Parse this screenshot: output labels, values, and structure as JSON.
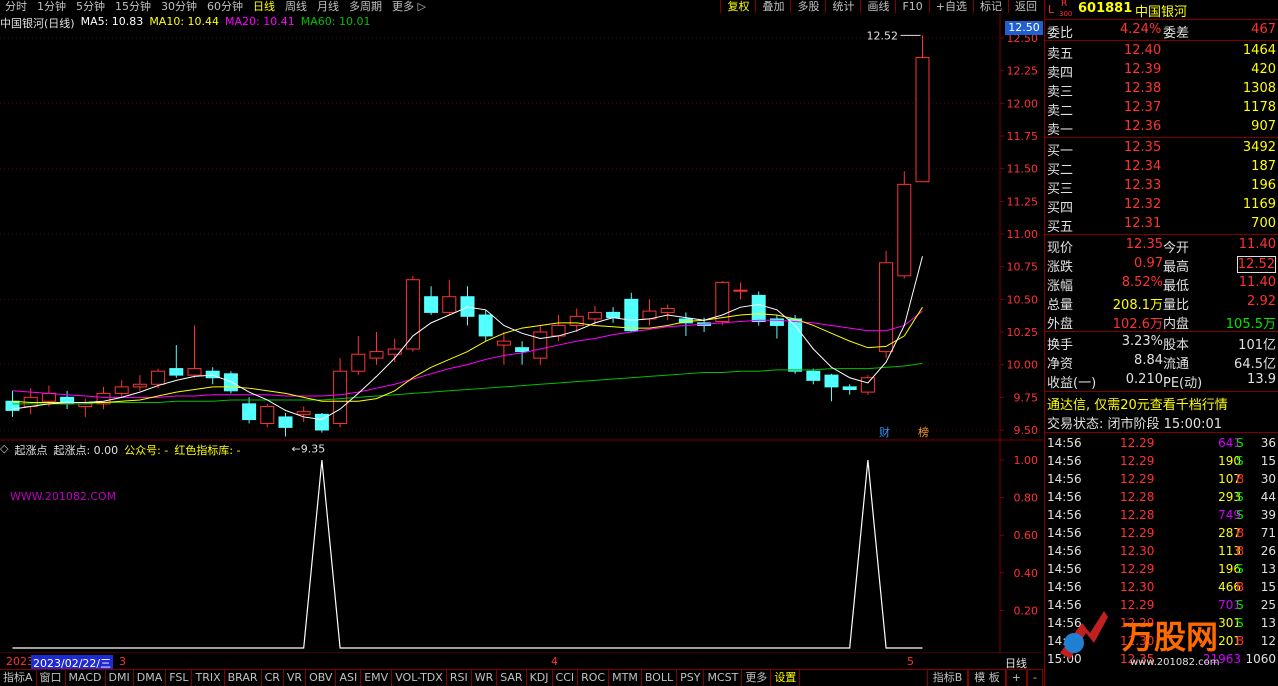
{
  "topbar": {
    "items": [
      {
        "label": "分时",
        "active": false
      },
      {
        "label": "1分钟",
        "active": false
      },
      {
        "label": "5分钟",
        "active": false
      },
      {
        "label": "15分钟",
        "active": false
      },
      {
        "label": "30分钟",
        "active": false
      },
      {
        "label": "60分钟",
        "active": false
      },
      {
        "label": "日线",
        "active": true
      },
      {
        "label": "周线",
        "active": false
      },
      {
        "label": "月线",
        "active": false
      },
      {
        "label": "多周期",
        "active": false
      },
      {
        "label": "更多 ▷",
        "active": false
      }
    ],
    "right_items": [
      {
        "label": "复权",
        "active": true
      },
      {
        "label": "叠加",
        "active": false
      },
      {
        "label": "多股",
        "active": false
      },
      {
        "label": "统计",
        "active": false
      },
      {
        "label": "画线",
        "active": false
      },
      {
        "label": "F10",
        "active": false
      },
      {
        "label": "+自选",
        "active": false
      },
      {
        "label": "标记",
        "active": false
      },
      {
        "label": "返回",
        "active": false
      }
    ]
  },
  "chart_info": {
    "stock_title": "中国银河(日线)",
    "ma5": "MA5: 10.83",
    "ma10": "MA10: 10.44",
    "ma20": "MA20: 10.41",
    "ma60": "MA60: 10.01",
    "current_price_tag": "12.50",
    "high_label": "12.52",
    "low_label": "9.35",
    "cai_badge": "财",
    "bang_badge": "榜"
  },
  "chart_data": [
    {
      "type": "candlestick",
      "title": "中国银河(日线)",
      "y_ticks": [
        "12.50",
        "12.25",
        "12.00",
        "11.75",
        "11.50",
        "11.25",
        "11.00",
        "10.75",
        "10.50",
        "10.25",
        "10.00",
        "9.75",
        "9.50"
      ],
      "ylim": [
        9.35,
        12.55
      ],
      "candles": [
        {
          "o": 9.72,
          "c": 9.65,
          "h": 9.8,
          "l": 9.6
        },
        {
          "o": 9.68,
          "c": 9.75,
          "h": 9.82,
          "l": 9.62
        },
        {
          "o": 9.72,
          "c": 9.78,
          "h": 9.84,
          "l": 9.68
        },
        {
          "o": 9.75,
          "c": 9.7,
          "h": 9.8,
          "l": 9.66
        },
        {
          "o": 9.68,
          "c": 9.7,
          "h": 9.74,
          "l": 9.6
        },
        {
          "o": 9.7,
          "c": 9.78,
          "h": 9.83,
          "l": 9.66
        },
        {
          "o": 9.78,
          "c": 9.83,
          "h": 9.88,
          "l": 9.75
        },
        {
          "o": 9.83,
          "c": 9.85,
          "h": 9.92,
          "l": 9.8
        },
        {
          "o": 9.85,
          "c": 9.95,
          "h": 9.97,
          "l": 9.82
        },
        {
          "o": 9.97,
          "c": 9.92,
          "h": 10.15,
          "l": 9.9
        },
        {
          "o": 9.92,
          "c": 9.97,
          "h": 10.3,
          "l": 9.9
        },
        {
          "o": 9.95,
          "c": 9.9,
          "h": 9.98,
          "l": 9.85
        },
        {
          "o": 9.93,
          "c": 9.8,
          "h": 9.95,
          "l": 9.78
        },
        {
          "o": 9.7,
          "c": 9.58,
          "h": 9.75,
          "l": 9.55
        },
        {
          "o": 9.55,
          "c": 9.68,
          "h": 9.7,
          "l": 9.52
        },
        {
          "o": 9.6,
          "c": 9.52,
          "h": 9.63,
          "l": 9.45
        },
        {
          "o": 9.62,
          "c": 9.64,
          "h": 9.68,
          "l": 9.56
        },
        {
          "o": 9.62,
          "c": 9.5,
          "h": 9.63,
          "l": 9.48
        },
        {
          "o": 9.55,
          "c": 9.95,
          "h": 10.05,
          "l": 9.52
        },
        {
          "o": 9.95,
          "c": 10.08,
          "h": 10.22,
          "l": 9.92
        },
        {
          "o": 10.05,
          "c": 10.1,
          "h": 10.25,
          "l": 10.0
        },
        {
          "o": 10.08,
          "c": 10.12,
          "h": 10.2,
          "l": 10.02
        },
        {
          "o": 10.12,
          "c": 10.65,
          "h": 10.68,
          "l": 10.1
        },
        {
          "o": 10.52,
          "c": 10.4,
          "h": 10.6,
          "l": 10.38
        },
        {
          "o": 10.4,
          "c": 10.52,
          "h": 10.65,
          "l": 10.38
        },
        {
          "o": 10.52,
          "c": 10.37,
          "h": 10.6,
          "l": 10.3
        },
        {
          "o": 10.38,
          "c": 10.22,
          "h": 10.42,
          "l": 10.18
        },
        {
          "o": 10.15,
          "c": 10.18,
          "h": 10.25,
          "l": 10.0
        },
        {
          "o": 10.13,
          "c": 10.1,
          "h": 10.18,
          "l": 10.0
        },
        {
          "o": 10.05,
          "c": 10.25,
          "h": 10.3,
          "l": 10.0
        },
        {
          "o": 10.22,
          "c": 10.3,
          "h": 10.38,
          "l": 10.18
        },
        {
          "o": 10.3,
          "c": 10.37,
          "h": 10.43,
          "l": 10.25
        },
        {
          "o": 10.35,
          "c": 10.4,
          "h": 10.45,
          "l": 10.3
        },
        {
          "o": 10.4,
          "c": 10.36,
          "h": 10.44,
          "l": 10.32
        },
        {
          "o": 10.5,
          "c": 10.26,
          "h": 10.55,
          "l": 10.25
        },
        {
          "o": 10.35,
          "c": 10.41,
          "h": 10.5,
          "l": 10.3
        },
        {
          "o": 10.4,
          "c": 10.43,
          "h": 10.46,
          "l": 10.34
        },
        {
          "o": 10.35,
          "c": 10.32,
          "h": 10.4,
          "l": 10.22
        },
        {
          "o": 10.32,
          "c": 10.3,
          "h": 10.36,
          "l": 10.25
        },
        {
          "o": 10.33,
          "c": 10.63,
          "h": 10.64,
          "l": 10.3
        },
        {
          "o": 10.57,
          "c": 10.57,
          "h": 10.63,
          "l": 10.5
        },
        {
          "o": 10.53,
          "c": 10.33,
          "h": 10.56,
          "l": 10.3
        },
        {
          "o": 10.35,
          "c": 10.3,
          "h": 10.38,
          "l": 10.2
        },
        {
          "o": 10.35,
          "c": 9.95,
          "h": 10.38,
          "l": 9.93
        },
        {
          "o": 9.95,
          "c": 9.88,
          "h": 9.97,
          "l": 9.85
        },
        {
          "o": 9.92,
          "c": 9.83,
          "h": 9.93,
          "l": 9.72
        },
        {
          "o": 9.83,
          "c": 9.81,
          "h": 9.85,
          "l": 9.77
        },
        {
          "o": 9.79,
          "c": 9.9,
          "h": 9.92,
          "l": 9.77
        },
        {
          "o": 10.1,
          "c": 10.78,
          "h": 10.87,
          "l": 10.05
        },
        {
          "o": 10.68,
          "c": 11.38,
          "h": 11.48,
          "l": 10.66
        },
        {
          "o": 11.4,
          "c": 12.35,
          "h": 12.52,
          "l": 11.4
        }
      ],
      "ma5": [
        9.66,
        9.68,
        9.7,
        9.71,
        9.71,
        9.72,
        9.75,
        9.79,
        9.84,
        9.88,
        9.91,
        9.92,
        9.87,
        9.79,
        9.73,
        9.65,
        9.6,
        9.58,
        9.66,
        9.78,
        9.91,
        10.05,
        10.22,
        10.32,
        10.38,
        10.44,
        10.42,
        10.3,
        10.24,
        10.2,
        10.22,
        10.26,
        10.32,
        10.36,
        10.34,
        10.35,
        10.38,
        10.36,
        10.34,
        10.38,
        10.44,
        10.46,
        10.42,
        10.3,
        10.12,
        9.98,
        9.9,
        9.86,
        10.02,
        10.3,
        10.83
      ],
      "ma10": [
        9.72,
        9.71,
        9.71,
        9.71,
        9.71,
        9.71,
        9.72,
        9.73,
        9.76,
        9.79,
        9.81,
        9.83,
        9.83,
        9.82,
        9.8,
        9.78,
        9.75,
        9.72,
        9.72,
        9.72,
        9.74,
        9.8,
        9.9,
        9.98,
        10.04,
        10.1,
        10.18,
        10.24,
        10.28,
        10.3,
        10.32,
        10.32,
        10.3,
        10.29,
        10.28,
        10.28,
        10.3,
        10.33,
        10.34,
        10.36,
        10.38,
        10.39,
        10.38,
        10.35,
        10.3,
        10.24,
        10.18,
        10.13,
        10.14,
        10.22,
        10.44
      ],
      "ma20": [
        9.8,
        9.79,
        9.78,
        9.77,
        9.76,
        9.75,
        9.75,
        9.75,
        9.75,
        9.76,
        9.76,
        9.77,
        9.77,
        9.77,
        9.77,
        9.76,
        9.76,
        9.76,
        9.77,
        9.79,
        9.82,
        9.85,
        9.89,
        9.93,
        9.97,
        10.0,
        10.04,
        10.07,
        10.09,
        10.12,
        10.15,
        10.18,
        10.2,
        10.23,
        10.25,
        10.27,
        10.29,
        10.3,
        10.31,
        10.32,
        10.33,
        10.34,
        10.34,
        10.33,
        10.32,
        10.3,
        10.28,
        10.26,
        10.26,
        10.3,
        10.41
      ],
      "ma60": [
        9.7,
        9.7,
        9.7,
        9.7,
        9.7,
        9.71,
        9.71,
        9.71,
        9.71,
        9.72,
        9.72,
        9.72,
        9.73,
        9.73,
        9.73,
        9.73,
        9.73,
        9.73,
        9.74,
        9.75,
        9.76,
        9.77,
        9.78,
        9.79,
        9.8,
        9.81,
        9.82,
        9.83,
        9.84,
        9.85,
        9.86,
        9.87,
        9.88,
        9.89,
        9.9,
        9.91,
        9.92,
        9.93,
        9.94,
        9.94,
        9.95,
        9.95,
        9.96,
        9.96,
        9.96,
        9.97,
        9.97,
        9.97,
        9.98,
        9.99,
        10.01
      ]
    },
    {
      "type": "line",
      "title": "起涨点",
      "y_ticks": [
        "1.00",
        "0.80",
        "0.60",
        "0.40",
        "0.20"
      ],
      "ylim": [
        0,
        1.05
      ],
      "values": [
        0,
        0,
        0,
        0,
        0,
        0,
        0,
        0,
        0,
        0,
        0,
        0,
        0,
        0,
        0,
        0,
        0,
        1,
        0,
        0,
        0,
        0,
        0,
        0,
        0,
        0,
        0,
        0,
        0,
        0,
        0,
        0,
        0,
        0,
        0,
        0,
        0,
        0,
        0,
        0,
        0,
        0,
        0,
        0,
        0,
        0,
        0,
        1,
        0,
        0,
        0
      ]
    }
  ],
  "indicator": {
    "name": "起涨点",
    "value_label": "起涨点: 0.00",
    "extra1": "公众号: -",
    "extra2": "红色指标库: -",
    "watermark": "WWW.201082.COM"
  },
  "dateaxis": {
    "left": "2023",
    "date_box": "2023/02/22/三",
    "m3": "3",
    "m4": "4",
    "m5": "5",
    "right": "日线"
  },
  "bottom_tabs": [
    {
      "label": "指标A",
      "active": false
    },
    {
      "label": "窗口",
      "active": false
    },
    {
      "label": "MACD",
      "active": false
    },
    {
      "label": "DMI",
      "active": false
    },
    {
      "label": "DMA",
      "active": false
    },
    {
      "label": "FSL",
      "active": false
    },
    {
      "label": "TRIX",
      "active": false
    },
    {
      "label": "BRAR",
      "active": false
    },
    {
      "label": "CR",
      "active": false
    },
    {
      "label": "VR",
      "active": false
    },
    {
      "label": "OBV",
      "active": false
    },
    {
      "label": "ASI",
      "active": false
    },
    {
      "label": "EMV",
      "active": false
    },
    {
      "label": "VOL-TDX",
      "active": false
    },
    {
      "label": "RSI",
      "active": false
    },
    {
      "label": "WR",
      "active": false
    },
    {
      "label": "SAR",
      "active": false
    },
    {
      "label": "KDJ",
      "active": false
    },
    {
      "label": "CCI",
      "active": false
    },
    {
      "label": "ROC",
      "active": false
    },
    {
      "label": "MTM",
      "active": false
    },
    {
      "label": "BOLL",
      "active": false
    },
    {
      "label": "PSY",
      "active": false
    },
    {
      "label": "MCST",
      "active": false
    },
    {
      "label": "更多",
      "active": false
    },
    {
      "label": "设置",
      "active": true
    }
  ],
  "bottom_tabs_right": [
    "指标B",
    "模 板",
    "+",
    "-"
  ],
  "quote": {
    "market_l": "L",
    "market_r": "R",
    "market_300": "300",
    "code": "601881",
    "name": "中国银河",
    "weibi_label": "委比",
    "weibi": "4.24%",
    "weicha_label": "委差",
    "weicha": "467",
    "sell": [
      {
        "label": "卖五",
        "price": "12.40",
        "vol": "1464"
      },
      {
        "label": "卖四",
        "price": "12.39",
        "vol": "420"
      },
      {
        "label": "卖三",
        "price": "12.38",
        "vol": "1308"
      },
      {
        "label": "卖二",
        "price": "12.37",
        "vol": "1178"
      },
      {
        "label": "卖一",
        "price": "12.36",
        "vol": "907"
      }
    ],
    "buy": [
      {
        "label": "买一",
        "price": "12.35",
        "vol": "3492"
      },
      {
        "label": "买二",
        "price": "12.34",
        "vol": "187"
      },
      {
        "label": "买三",
        "price": "12.33",
        "vol": "196"
      },
      {
        "label": "买四",
        "price": "12.32",
        "vol": "1169"
      },
      {
        "label": "买五",
        "price": "12.31",
        "vol": "700"
      }
    ],
    "stats": [
      {
        "l1": "现价",
        "v1": "12.35",
        "c1": "red",
        "l2": "今开",
        "v2": "11.40",
        "c2": "red"
      },
      {
        "l1": "涨跌",
        "v1": "0.97",
        "c1": "red",
        "l2": "最高",
        "v2": "12.52",
        "c2": "red"
      },
      {
        "l1": "涨幅",
        "v1": "8.52%",
        "c1": "red",
        "l2": "最低",
        "v2": "11.40",
        "c2": "red"
      },
      {
        "l1": "总量",
        "v1": "208.1万",
        "c1": "yellow",
        "l2": "量比",
        "v2": "2.92",
        "c2": "red"
      },
      {
        "l1": "外盘",
        "v1": "102.6万",
        "c1": "red",
        "l2": "内盘",
        "v2": "105.5万",
        "c2": "green"
      }
    ],
    "fundamentals": [
      {
        "l1": "换手",
        "v1": "3.23%",
        "l2": "股本",
        "v2": "101亿"
      },
      {
        "l1": "净资",
        "v1": "8.84",
        "l2": "流通",
        "v2": "64.5亿"
      },
      {
        "l1": "收益(一)",
        "v1": "0.210",
        "l2": "PE(动)",
        "v2": "13.9"
      }
    ],
    "ad_text": "通达信, 仅需20元查看千档行情",
    "trade_status": "交易状态: 闭市阶段 15:00:01"
  },
  "ticks": [
    {
      "t": "14:56",
      "p": "12.29",
      "v": "641",
      "bs": "S",
      "n": "36",
      "vc": "purple",
      "bsc": "green"
    },
    {
      "t": "14:56",
      "p": "12.29",
      "v": "190",
      "bs": "S",
      "n": "15",
      "vc": "yellow",
      "bsc": "green"
    },
    {
      "t": "14:56",
      "p": "12.29",
      "v": "107",
      "bs": "B",
      "n": "30",
      "vc": "yellow",
      "bsc": "red"
    },
    {
      "t": "14:56",
      "p": "12.28",
      "v": "293",
      "bs": "S",
      "n": "44",
      "vc": "yellow",
      "bsc": "green"
    },
    {
      "t": "14:56",
      "p": "12.28",
      "v": "749",
      "bs": "S",
      "n": "39",
      "vc": "purple",
      "bsc": "green"
    },
    {
      "t": "14:56",
      "p": "12.29",
      "v": "287",
      "bs": "B",
      "n": "71",
      "vc": "yellow",
      "bsc": "red"
    },
    {
      "t": "14:56",
      "p": "12.30",
      "v": "113",
      "bs": "B",
      "n": "26",
      "vc": "yellow",
      "bsc": "red"
    },
    {
      "t": "14:56",
      "p": "12.29",
      "v": "196",
      "bs": "S",
      "n": "13",
      "vc": "yellow",
      "bsc": "green"
    },
    {
      "t": "14:56",
      "p": "12.30",
      "v": "466",
      "bs": "B",
      "n": "15",
      "vc": "yellow",
      "bsc": "red"
    },
    {
      "t": "14:56",
      "p": "12.29",
      "v": "701",
      "bs": "S",
      "n": "25",
      "vc": "purple",
      "bsc": "green"
    },
    {
      "t": "14:56",
      "p": "12.29",
      "v": "301",
      "bs": "S",
      "n": "13",
      "vc": "yellow",
      "bsc": "green"
    },
    {
      "t": "14:56",
      "p": "12.30",
      "v": "201",
      "bs": "B",
      "n": "12",
      "vc": "yellow",
      "bsc": "red"
    },
    {
      "t": "15:00",
      "p": "12.35",
      "v": "21963",
      "bs": "",
      "n": "1060",
      "vc": "purple",
      "bsc": "green"
    }
  ],
  "ad_logo": {
    "text": "万股网",
    "url": "www.201082.com"
  },
  "colors": {
    "up": "#ff3232",
    "down": "#54ffff",
    "ma5": "#ffffff",
    "ma10": "#ffff00",
    "ma20": "#ff00ff",
    "ma60": "#00c000",
    "grid": "#800000",
    "indicator_line": "#ffffff"
  }
}
